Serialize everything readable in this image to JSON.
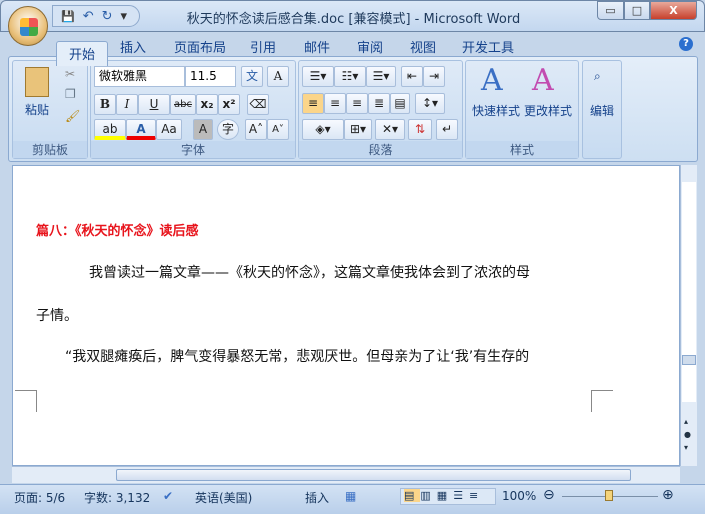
{
  "window": {
    "title": "秋天的怀念读后感合集.doc [兼容模式] - Microsoft Word",
    "minimize": "▭",
    "maximize": "□",
    "close": "X"
  },
  "qat": {
    "save": "💾",
    "undo": "↶",
    "redo": "↻",
    "customize": "▾"
  },
  "tabs": [
    "开始",
    "插入",
    "页面布局",
    "引用",
    "邮件",
    "审阅",
    "视图",
    "开发工具"
  ],
  "help": "?",
  "clipboard": {
    "paste": "粘贴",
    "label": "剪贴板"
  },
  "font": {
    "name": "微软雅黑",
    "size": "11.5",
    "bold": "B",
    "italic": "I",
    "underline": "U",
    "strike": "abc",
    "sub": "x₂",
    "sup": "x²",
    "case": "Aa",
    "grow": "A˄",
    "shrink": "A˅",
    "phonetic": "文",
    "border": "A",
    "shading": "A",
    "enclose": "字",
    "label": "字体"
  },
  "paragraph": {
    "label": "段落"
  },
  "styles": {
    "quick": "快速样式",
    "change": "更改样式",
    "label": "样式"
  },
  "editing": {
    "label": "编辑"
  },
  "document": {
    "heading": "篇八：《秋天的怀念》读后感",
    "p1": "我曾读过一篇文章——《秋天的怀念》，这篇文章使我体会到了浓浓的母",
    "p2": "子情。",
    "p3": "“我双腿瘫痪后，脾气变得暴怒无常，悲观厌世。但母亲为了让‘我’有生存的",
    "heading_color": "#e8141c"
  },
  "status": {
    "page": "页面: 5/6",
    "words": "字数: 3,132",
    "language": "英语(美国)",
    "mode": "插入",
    "zoom": "100%",
    "zoom_percent": 100
  }
}
